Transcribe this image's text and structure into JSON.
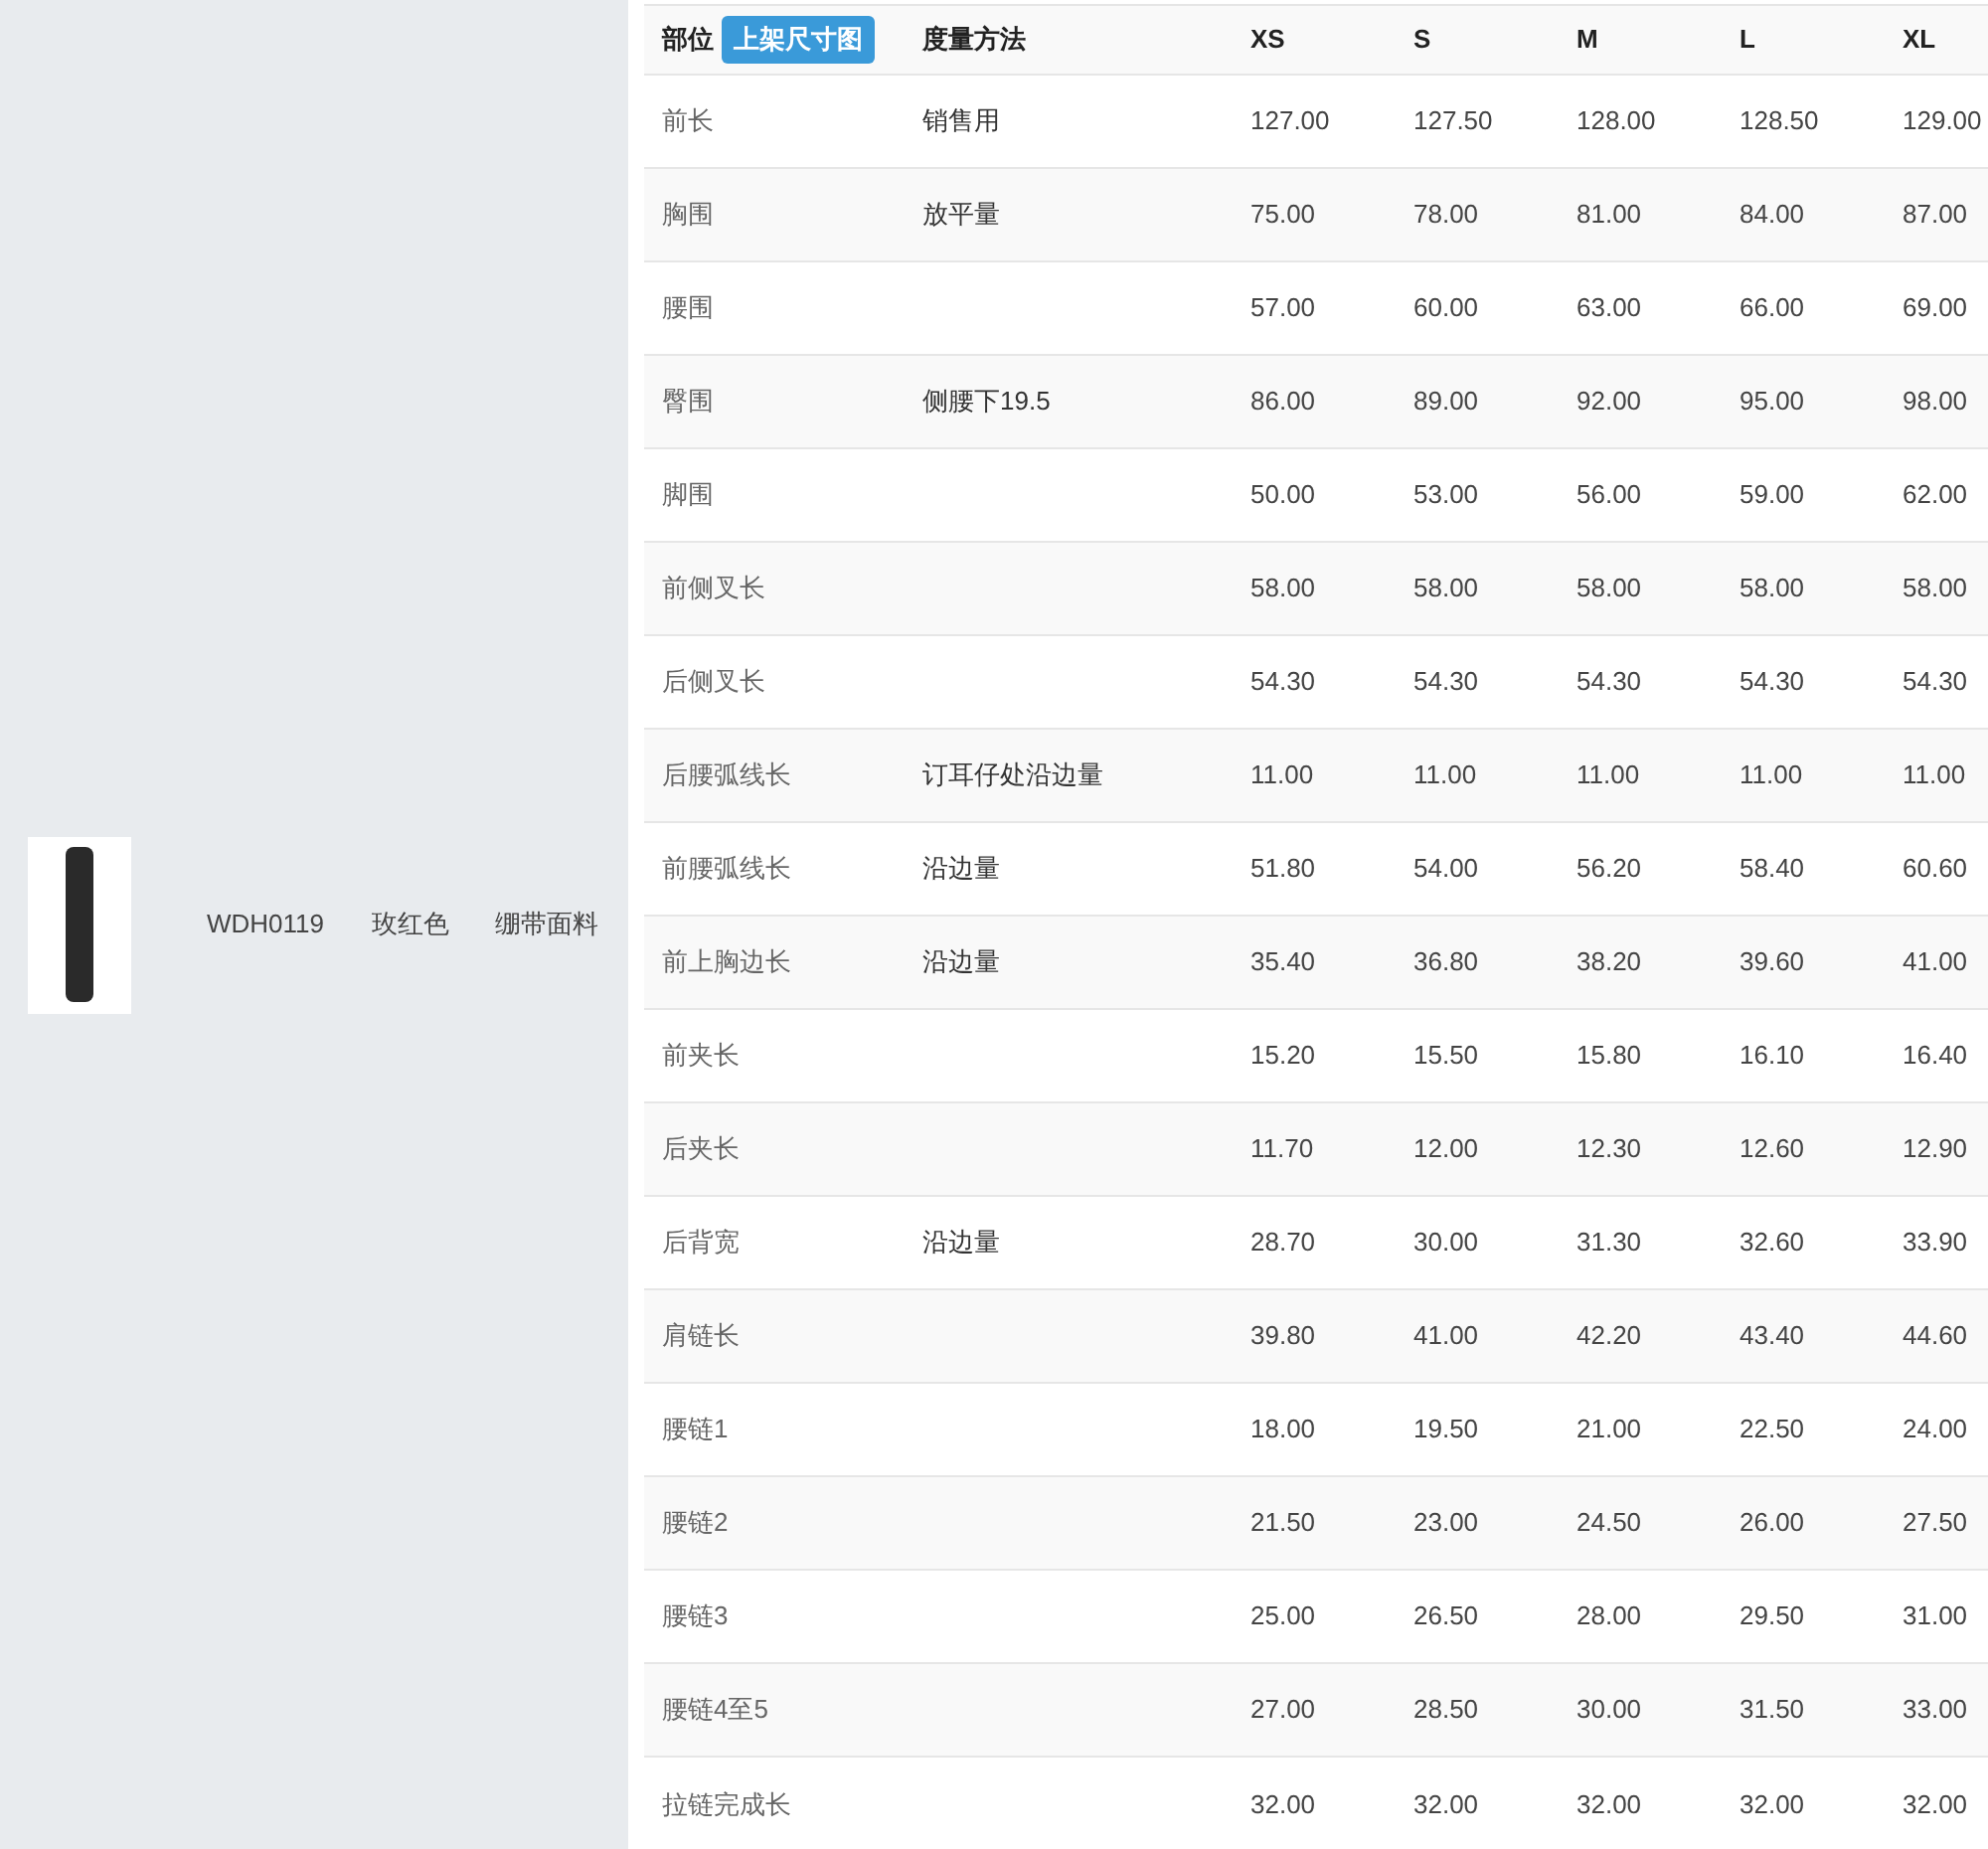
{
  "product": {
    "sku": "WDH0119",
    "variant": "玫红色",
    "material": "绷带面料"
  },
  "table": {
    "columns": [
      "部位",
      "度量方法",
      "XS",
      "S",
      "M",
      "L",
      "XL"
    ],
    "header_button": "上架尺寸图",
    "rows": [
      {
        "part": "前长",
        "method": "销售用",
        "values": [
          "127.00",
          "127.50",
          "128.00",
          "128.50",
          "129.00"
        ]
      },
      {
        "part": "胸围",
        "method": "放平量",
        "values": [
          "75.00",
          "78.00",
          "81.00",
          "84.00",
          "87.00"
        ]
      },
      {
        "part": "腰围",
        "method": "",
        "values": [
          "57.00",
          "60.00",
          "63.00",
          "66.00",
          "69.00"
        ]
      },
      {
        "part": "臀围",
        "method": "侧腰下19.5",
        "values": [
          "86.00",
          "89.00",
          "92.00",
          "95.00",
          "98.00"
        ]
      },
      {
        "part": "脚围",
        "method": "",
        "values": [
          "50.00",
          "53.00",
          "56.00",
          "59.00",
          "62.00"
        ]
      },
      {
        "part": "前侧叉长",
        "method": "",
        "values": [
          "58.00",
          "58.00",
          "58.00",
          "58.00",
          "58.00"
        ]
      },
      {
        "part": "后侧叉长",
        "method": "",
        "values": [
          "54.30",
          "54.30",
          "54.30",
          "54.30",
          "54.30"
        ]
      },
      {
        "part": "后腰弧线长",
        "method": "订耳仔处沿边量",
        "values": [
          "11.00",
          "11.00",
          "11.00",
          "11.00",
          "11.00"
        ]
      },
      {
        "part": "前腰弧线长",
        "method": "沿边量",
        "values": [
          "51.80",
          "54.00",
          "56.20",
          "58.40",
          "60.60"
        ]
      },
      {
        "part": "前上胸边长",
        "method": "沿边量",
        "values": [
          "35.40",
          "36.80",
          "38.20",
          "39.60",
          "41.00"
        ]
      },
      {
        "part": "前夹长",
        "method": "",
        "values": [
          "15.20",
          "15.50",
          "15.80",
          "16.10",
          "16.40"
        ]
      },
      {
        "part": "后夹长",
        "method": "",
        "values": [
          "11.70",
          "12.00",
          "12.30",
          "12.60",
          "12.90"
        ]
      },
      {
        "part": "后背宽",
        "method": "沿边量",
        "values": [
          "28.70",
          "30.00",
          "31.30",
          "32.60",
          "33.90"
        ]
      },
      {
        "part": "肩链长",
        "method": "",
        "values": [
          "39.80",
          "41.00",
          "42.20",
          "43.40",
          "44.60"
        ]
      },
      {
        "part": "腰链1",
        "method": "",
        "values": [
          "18.00",
          "19.50",
          "21.00",
          "22.50",
          "24.00"
        ]
      },
      {
        "part": "腰链2",
        "method": "",
        "values": [
          "21.50",
          "23.00",
          "24.50",
          "26.00",
          "27.50"
        ]
      },
      {
        "part": "腰链3",
        "method": "",
        "values": [
          "25.00",
          "26.50",
          "28.00",
          "29.50",
          "31.00"
        ]
      },
      {
        "part": "腰链4至5",
        "method": "",
        "values": [
          "27.00",
          "28.50",
          "30.00",
          "31.50",
          "33.00"
        ]
      },
      {
        "part": "拉链完成长",
        "method": "",
        "values": [
          "32.00",
          "32.00",
          "32.00",
          "32.00",
          "32.00"
        ]
      }
    ]
  }
}
